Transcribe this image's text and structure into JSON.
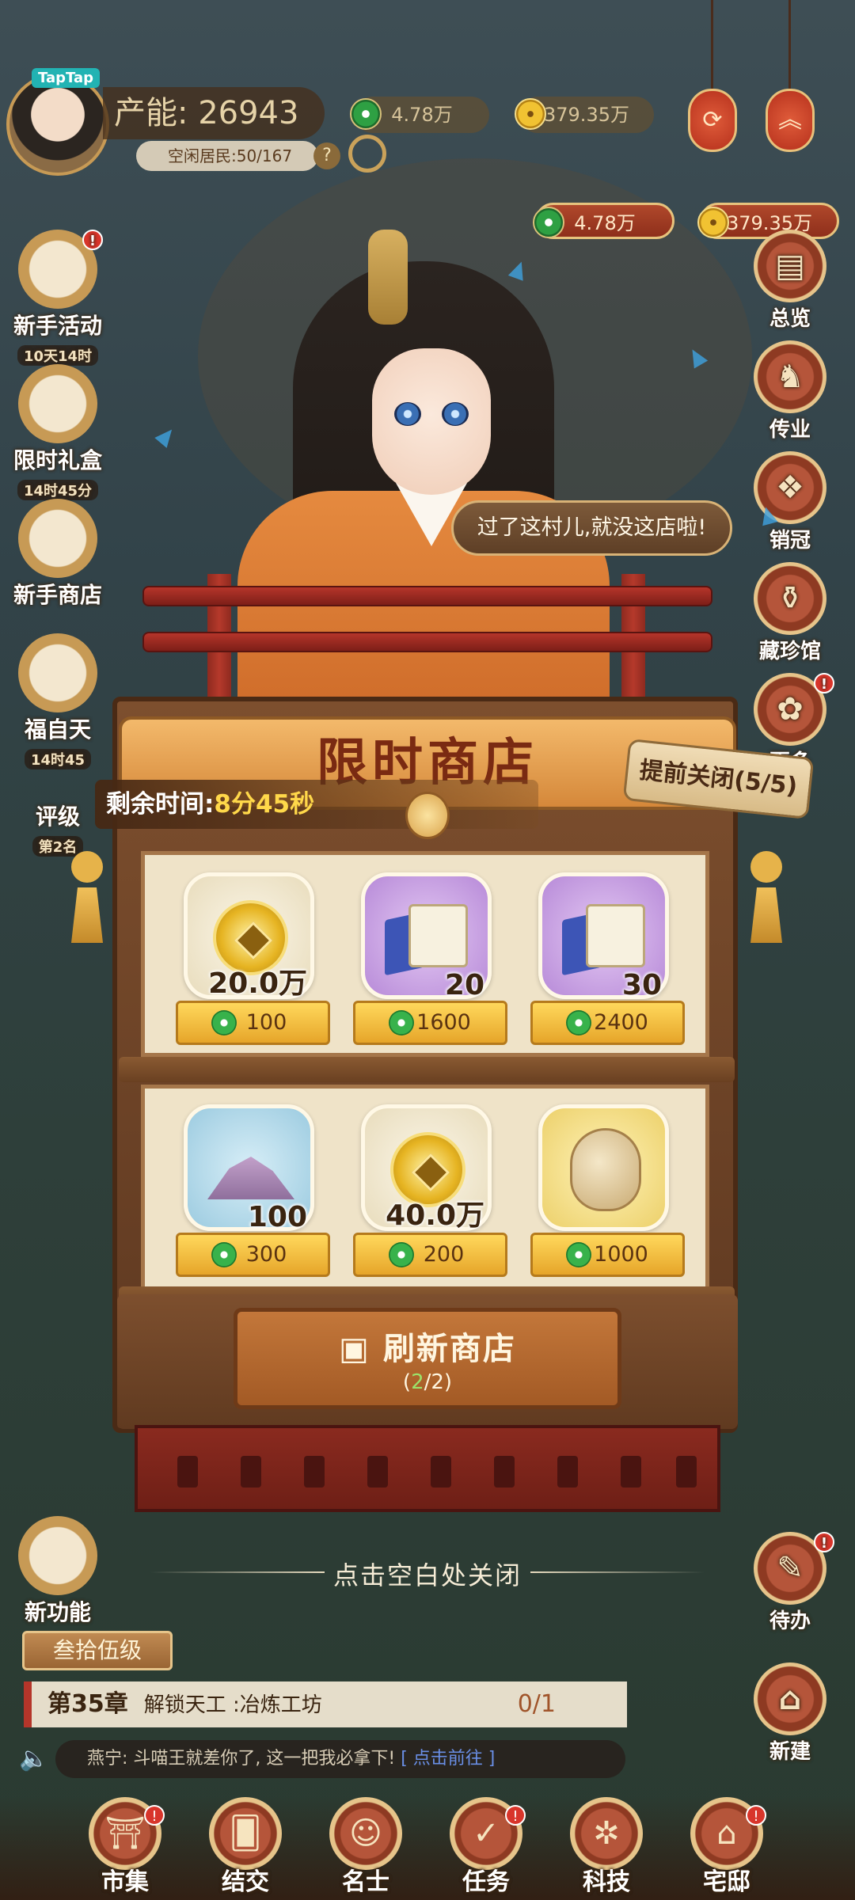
{
  "hud": {
    "taptap": "TapTap",
    "power_label": "产能:",
    "power_value": "26943",
    "residents": "空闲居民:50/167",
    "help": "?",
    "jade_top": "4.78万",
    "gold_top": "379.35万",
    "jade": "4.78万",
    "gold": "379.35万"
  },
  "left_menu": [
    {
      "label": "新手活动",
      "sub": "10天14时"
    },
    {
      "label": "限时礼盒",
      "sub": "14时45分"
    },
    {
      "label": "新手商店",
      "sub": ""
    },
    {
      "label": "福自天",
      "sub": "14时45"
    },
    {
      "label": "评级",
      "sub": "第2名"
    }
  ],
  "right_menu": [
    {
      "label": "总览"
    },
    {
      "label": "传业"
    },
    {
      "label": "销冠"
    },
    {
      "label": "藏珍馆"
    },
    {
      "label": "更多"
    }
  ],
  "speech": "过了这村儿,就没这店啦!",
  "shop": {
    "title": "限时商店",
    "timer_label": "剩余时间:",
    "timer_value": "8分45秒",
    "close_early": "提前关闭(5/5)",
    "items": [
      {
        "icon": "gold-coin-icon",
        "qty": "20.0万",
        "price": "100"
      },
      {
        "icon": "book-scroll-icon",
        "qty": "20",
        "price": "1600"
      },
      {
        "icon": "book-scroll-icon",
        "qty": "30",
        "price": "2400"
      },
      {
        "icon": "powder-pile-icon",
        "qty": "100",
        "price": "300"
      },
      {
        "icon": "gold-coin-icon",
        "qty": "40.0万",
        "price": "200"
      },
      {
        "icon": "carved-seed-icon",
        "qty": "",
        "price": "1000"
      }
    ],
    "refresh_label": "刷新商店",
    "refresh_open": "(",
    "refresh_used": "2",
    "refresh_total": "/2)"
  },
  "close_hint": "点击空白处关闭",
  "bottom": {
    "new_feature": "新功能",
    "level": "叁拾伍级",
    "chapter": "第35章",
    "chapter_task": "解锁天工 :冶炼工坊",
    "chapter_progress": "0/1",
    "todo": "待办",
    "build": "新建",
    "news_text": "燕宁: 斗喵王就差你了, 这一把我必拿下!",
    "news_link": "[ 点击前往 ]"
  },
  "nav": [
    {
      "label": "市集"
    },
    {
      "label": "结交"
    },
    {
      "label": "名士"
    },
    {
      "label": "任务"
    },
    {
      "label": "科技"
    },
    {
      "label": "宅邸"
    }
  ],
  "colors": {
    "accent_red": "#b5352a",
    "gold": "#ffd84a",
    "jade": "#2ea043",
    "wood": "#7d4f2e"
  }
}
